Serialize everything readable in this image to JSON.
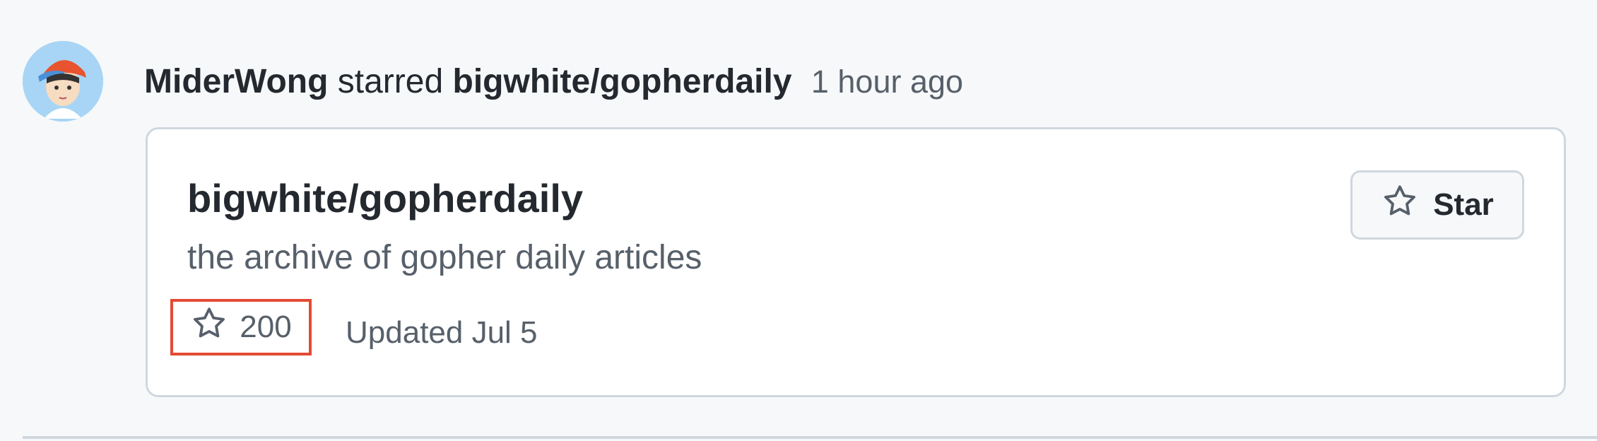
{
  "event": {
    "actor": "MiderWong",
    "action": "starred",
    "repo": "bigwhite/gopherdaily",
    "time": "1 hour ago"
  },
  "card": {
    "repo_name": "bigwhite/gopherdaily",
    "description": "the archive of gopher daily articles",
    "stars": "200",
    "updated": "Updated Jul 5",
    "star_button_label": "Star"
  },
  "icons": {
    "avatar": "user-avatar",
    "meta_star": "star-icon",
    "button_star": "star-icon"
  },
  "colors": {
    "highlight_border": "#e34a33",
    "muted_text": "#57606a",
    "border": "#d0d7de"
  }
}
